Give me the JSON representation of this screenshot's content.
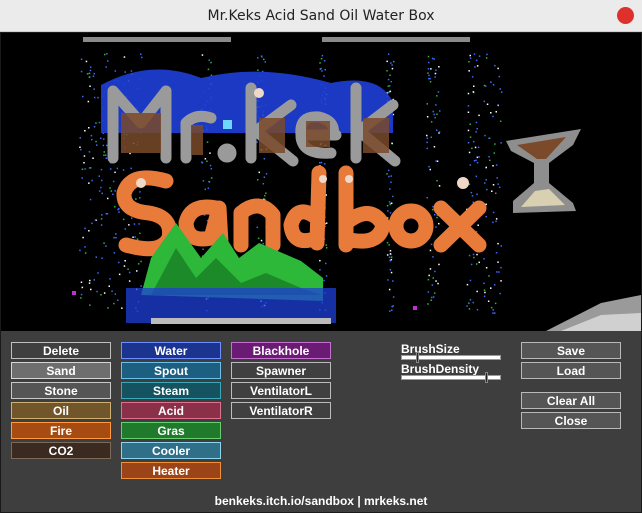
{
  "window": {
    "title": "Mr.Keks Acid Sand Oil Water Box"
  },
  "scene": {
    "logo_line1": "Mr.Keks",
    "logo_line2": "Sandbox"
  },
  "tools": {
    "column1": [
      {
        "label": "Delete",
        "bg": "#3f3f3f",
        "border": "#bfbfbf"
      },
      {
        "label": "Sand",
        "bg": "#6e6e6e",
        "border": "#d6d6d6"
      },
      {
        "label": "Stone",
        "bg": "#555555",
        "border": "#c8c8c8"
      },
      {
        "label": "Oil",
        "bg": "#70562a",
        "border": "#d0b070"
      },
      {
        "label": "Fire",
        "bg": "#a64c12",
        "border": "#ff9a40"
      },
      {
        "label": "CO2",
        "bg": "#3a2a20",
        "border": "#7a6a5a"
      }
    ],
    "column2": [
      {
        "label": "Water",
        "bg": "#1a3490",
        "border": "#6f8fff"
      },
      {
        "label": "Spout",
        "bg": "#1d5f80",
        "border": "#6cc0e8"
      },
      {
        "label": "Steam",
        "bg": "#14535f",
        "border": "#3fa8b8"
      },
      {
        "label": "Acid",
        "bg": "#8a3048",
        "border": "#e07090"
      },
      {
        "label": "Gras",
        "bg": "#1f7a2c",
        "border": "#69d071"
      },
      {
        "label": "Cooler",
        "bg": "#2f6f88",
        "border": "#8fd4ee"
      },
      {
        "label": "Heater",
        "bg": "#9a4418",
        "border": "#f0903a"
      }
    ],
    "column3": [
      {
        "label": "Blackhole",
        "bg": "#6a1b74",
        "border": "#c56fd0"
      },
      {
        "label": "Spawner",
        "bg": "#404040",
        "border": "#bcbcbc"
      },
      {
        "label": "VentilatorL",
        "bg": "#404040",
        "border": "#bcbcbc"
      },
      {
        "label": "VentilatorR",
        "bg": "#404040",
        "border": "#bcbcbc"
      }
    ]
  },
  "brush": {
    "size_label": "BrushSize",
    "size_value": 0.15,
    "density_label": "BrushDensity",
    "density_value": 0.86
  },
  "actions": {
    "save": "Save",
    "load": "Load",
    "clear_all": "Clear All",
    "close": "Close"
  },
  "footer": {
    "text": "benkeks.itch.io/sandbox  |  mrkeks.net"
  },
  "colors": {
    "titlebar": "#ebebeb",
    "close": "#e0302b",
    "panel": "#3e3e3e",
    "sand": "#e87a3a",
    "stone": "#8a8a8a",
    "water": "#2a5cff",
    "grass": "#2db83a"
  }
}
